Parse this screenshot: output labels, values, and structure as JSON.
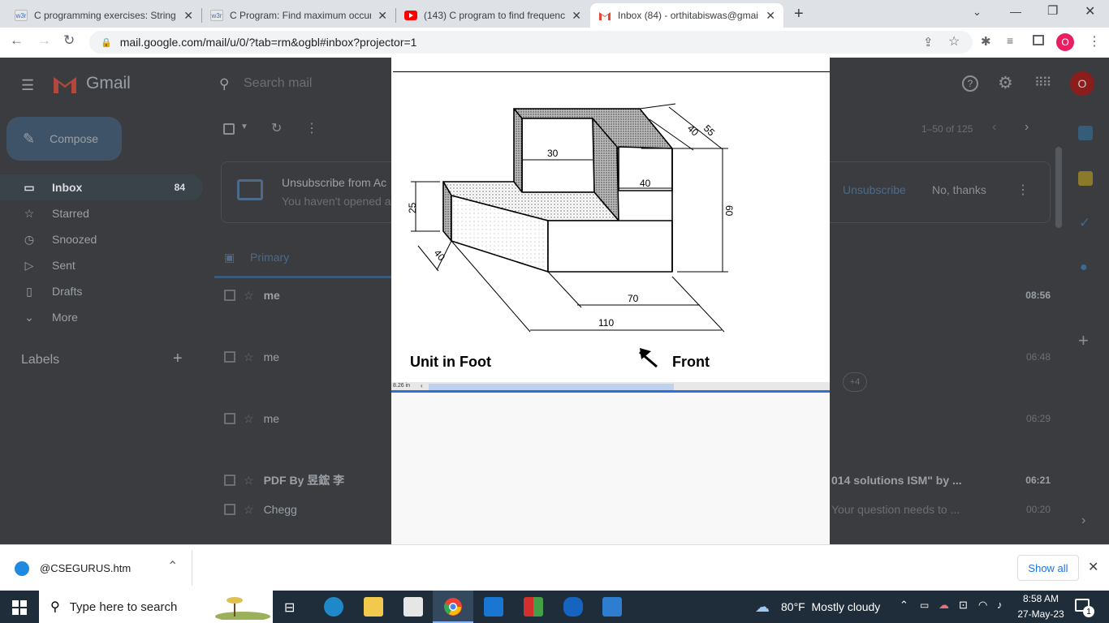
{
  "browser": {
    "tabs": [
      {
        "favicon": "w3r",
        "title": "C programming exercises: String",
        "active": false
      },
      {
        "favicon": "w3r",
        "title": "C Program: Find maximum occurr",
        "active": false
      },
      {
        "favicon": "youtube-icon",
        "title": "(143) C program to find frequenc",
        "active": false
      },
      {
        "favicon": "gmail-icon",
        "title": "Inbox (84) - orthitabiswas@gmai",
        "active": true
      }
    ],
    "new_tab": "+",
    "url": "mail.google.com/mail/u/0/?tab=rm&ogbl#inbox?projector=1",
    "profile_initial": "O"
  },
  "gmail": {
    "brand": "Gmail",
    "search_placeholder": "Search mail",
    "compose": "Compose",
    "nav": [
      {
        "label": "Inbox",
        "count": "84",
        "icon": "inbox-icon"
      },
      {
        "label": "Starred",
        "count": "",
        "icon": "star-icon"
      },
      {
        "label": "Snoozed",
        "count": "",
        "icon": "clock-icon"
      },
      {
        "label": "Sent",
        "count": "",
        "icon": "send-icon"
      },
      {
        "label": "Drafts",
        "count": "",
        "icon": "draft-icon"
      },
      {
        "label": "More",
        "count": "",
        "icon": "chevron-down-icon"
      }
    ],
    "labels_heading": "Labels",
    "pagination": "1–50 of 125",
    "banner": {
      "title": "Unsubscribe from Ac",
      "subtitle": "You haven't opened a",
      "unsubscribe": "Unsubscribe",
      "no_thanks": "No, thanks"
    },
    "primary_tab": "Primary",
    "emails": [
      {
        "sender": "me",
        "snippet": "",
        "time": "08:56",
        "unread": true
      },
      {
        "sender": "me",
        "snippet": "",
        "time": "06:48",
        "unread": false
      },
      {
        "sender": "me",
        "snippet": "",
        "time": "06:29",
        "unread": false
      },
      {
        "sender": "PDF By 昱鋐 李",
        "snippet": "014 solutions ISM\" by ...",
        "time": "06:21",
        "unread": true
      },
      {
        "sender": "Chegg",
        "snippet": "Your question needs to ...",
        "time": "00:20",
        "unread": false
      }
    ],
    "attachment_more": "+4"
  },
  "drawing": {
    "dimensions": [
      "55",
      "40",
      "40",
      "30",
      "60",
      "25",
      "40",
      "70",
      "110"
    ],
    "unit_label": "Unit in Foot",
    "front_label": "Front",
    "scrollbar_label": "8.26 in"
  },
  "downloads": {
    "file": "@CSEGURUS.htm",
    "show_all": "Show all"
  },
  "taskbar": {
    "search_placeholder": "Type here to search",
    "weather": "80°F  Mostly cloudy",
    "time": "8:58 AM",
    "date": "27-May-23",
    "notification_count": "1"
  }
}
